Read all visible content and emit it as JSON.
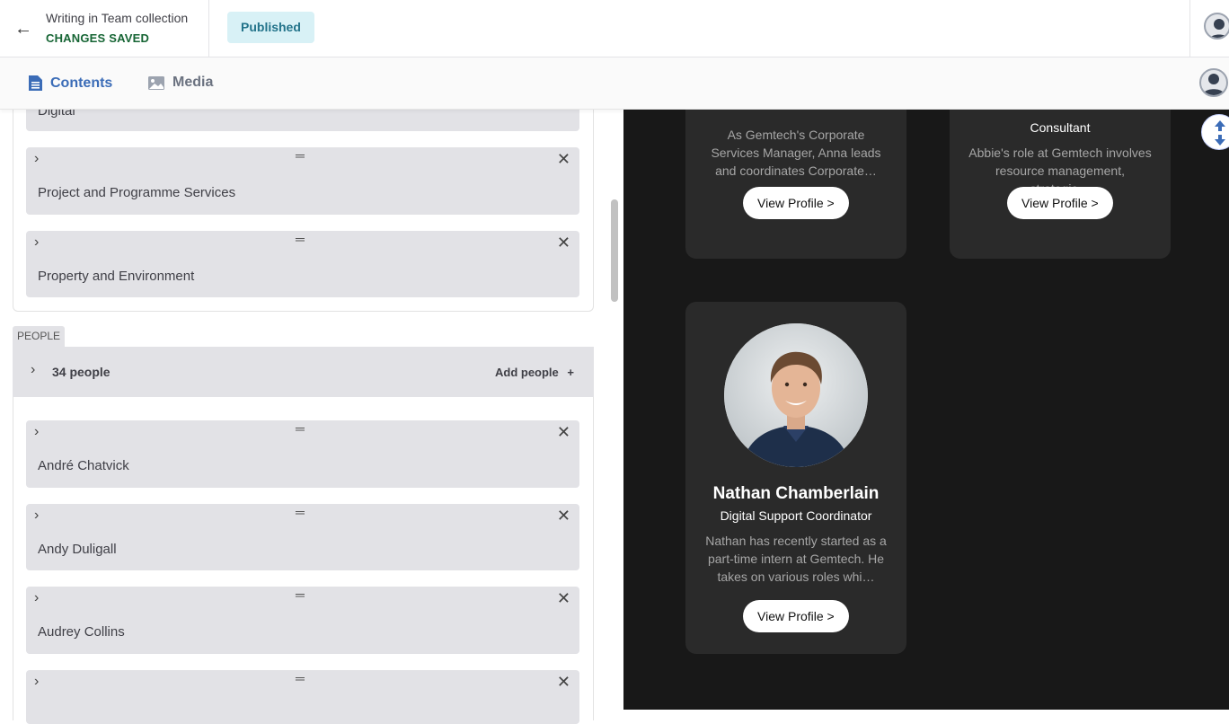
{
  "header": {
    "back_label": "←",
    "collection_title": "Writing in Team collection",
    "save_status": "CHANGES SAVED",
    "publish_status": "Published"
  },
  "tabs": [
    {
      "label": "Contents",
      "active": true
    },
    {
      "label": "Media",
      "active": false
    }
  ],
  "services_group": {
    "partial_item_label": "Digital",
    "items": [
      {
        "label": "Project and Programme Services"
      },
      {
        "label": "Property and Environment"
      }
    ]
  },
  "people": {
    "section_tag": "PEOPLE",
    "count_label": "34 people",
    "add_label": "Add people",
    "add_icon": "+",
    "items": [
      {
        "label": "André Chatvick"
      },
      {
        "label": "Andy Duligall"
      },
      {
        "label": "Audrey Collins"
      },
      {
        "label": ""
      }
    ]
  },
  "icons": {
    "chevron": "›",
    "drag": "═",
    "close": "✕"
  },
  "preview": {
    "cards": [
      {
        "name": "",
        "role": "",
        "description": "As Gemtech's Corporate Services Manager, Anna leads and coordinates Corporate…",
        "button": "View Profile >"
      },
      {
        "name": "",
        "role": "Consultant",
        "description": "Abbie's role at Gemtech involves resource management, strategic…",
        "button": "View Profile >"
      },
      {
        "name": "Nathan Chamberlain",
        "role": "Digital Support Coordinator",
        "description": "Nathan has recently started as a part-time intern at Gemtech. He takes on various roles whi…",
        "button": "View Profile >"
      }
    ]
  },
  "colors": {
    "accent_blue": "#3b6cb7",
    "saved_green": "#166534",
    "published_bg": "#d8f1f6",
    "preview_bg": "#181818",
    "card_bg": "#2a2a2a"
  }
}
